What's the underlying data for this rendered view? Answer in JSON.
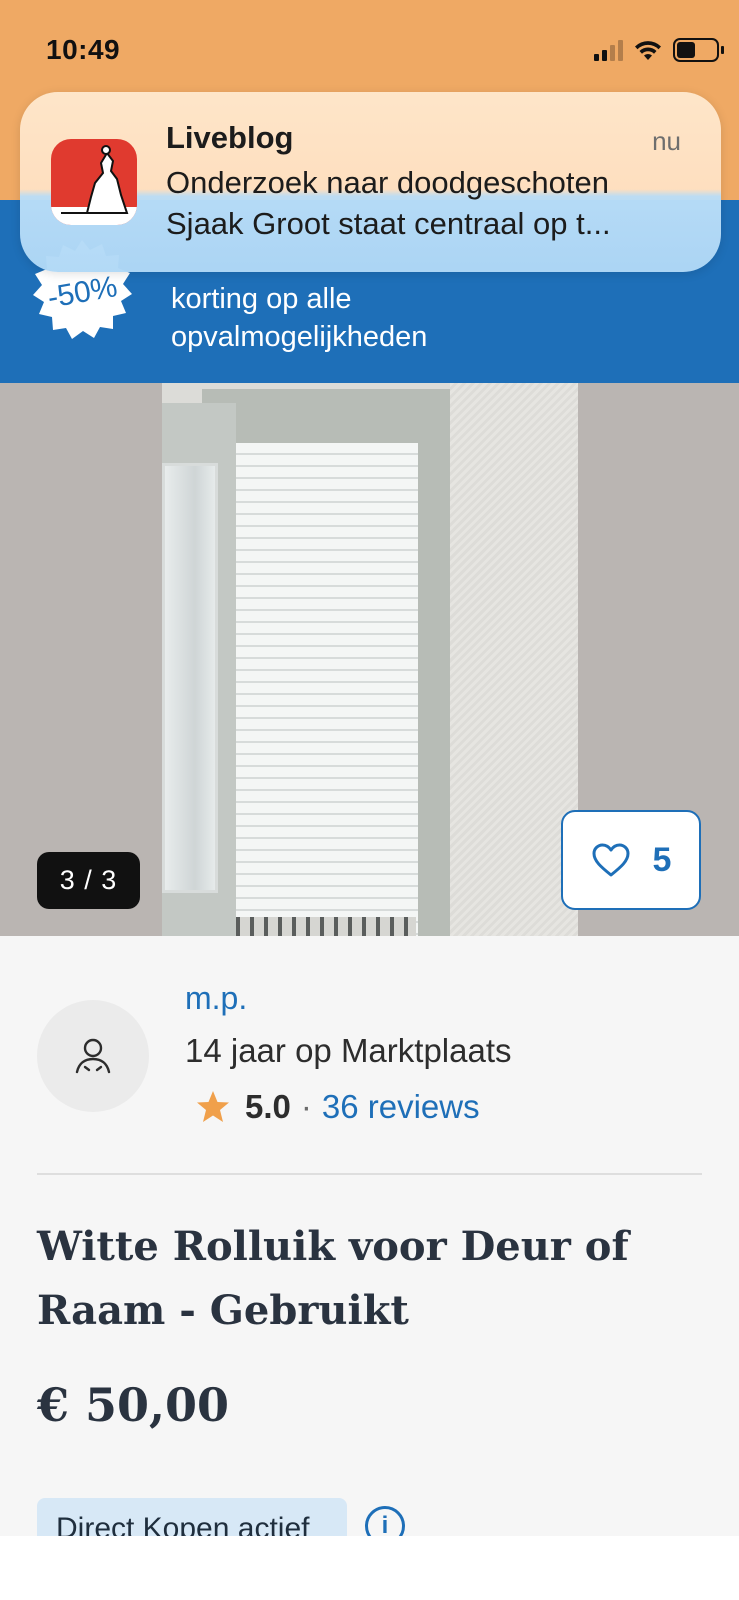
{
  "status_bar": {
    "time": "10:49"
  },
  "notification": {
    "app": "Liveblog",
    "time": "nu",
    "line1": "Onderzoek naar doodgeschoten",
    "line2": "Sjaak Groot staat centraal op t..."
  },
  "promo": {
    "badge": "-50%",
    "line1": "korting op alle",
    "line2": "opvalmogelijkheden"
  },
  "gallery": {
    "counter": "3 / 3",
    "favorites": "5"
  },
  "seller": {
    "name": "m.p.",
    "years": "14 jaar op Marktplaats",
    "rating": "5.0",
    "separator": "·",
    "reviews": "36 reviews"
  },
  "listing": {
    "title": "Witte Rolluik voor Deur of Raam - Gebruikt",
    "price": "€ 50,00",
    "chip": "Direct Kopen actief"
  },
  "colors": {
    "accent_blue": "#1e6fb8",
    "orange": "#efa964",
    "star": "#f0a04b",
    "text_dark": "#2a3340"
  }
}
